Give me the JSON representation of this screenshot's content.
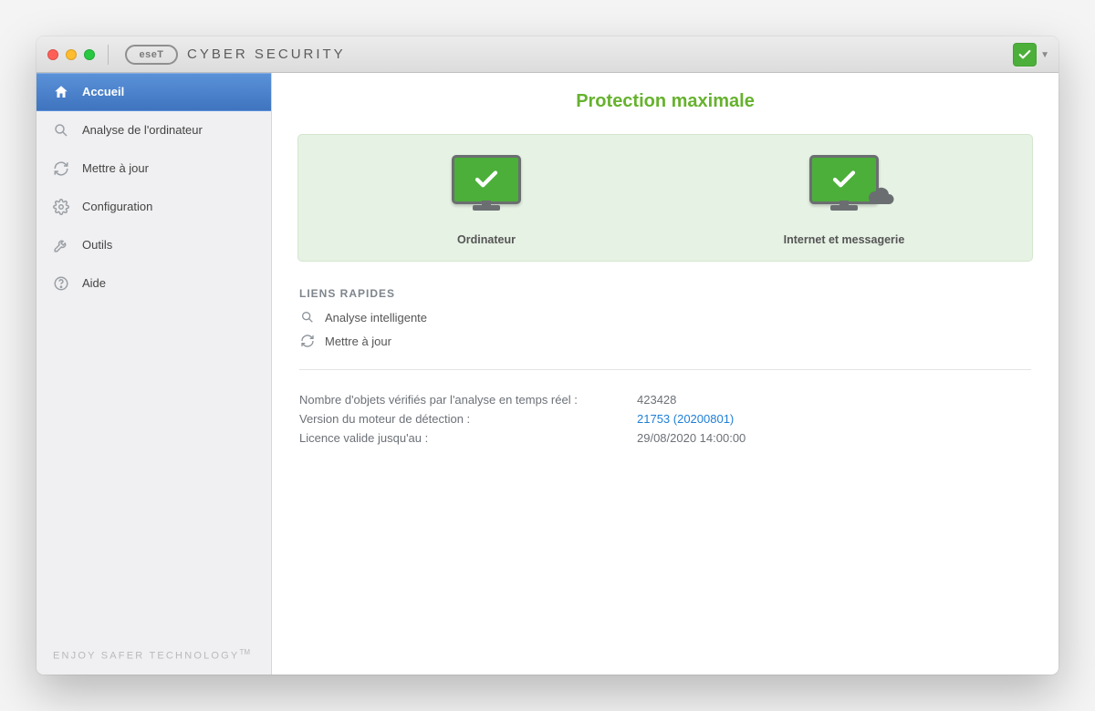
{
  "brand": {
    "logo_text": "eseT",
    "title": "CYBER SECURITY"
  },
  "sidebar": {
    "items": [
      {
        "label": "Accueil",
        "icon": "home-icon",
        "active": true
      },
      {
        "label": "Analyse de l'ordinateur",
        "icon": "search-icon"
      },
      {
        "label": "Mettre à jour",
        "icon": "refresh-icon"
      },
      {
        "label": "Configuration",
        "icon": "gear-icon"
      },
      {
        "label": "Outils",
        "icon": "tools-icon"
      },
      {
        "label": "Aide",
        "icon": "help-icon"
      }
    ],
    "footer": "ENJOY SAFER TECHNOLOGY",
    "footer_tm": "TM"
  },
  "main": {
    "headline": "Protection maximale",
    "cards": [
      {
        "label": "Ordinateur"
      },
      {
        "label": "Internet et messagerie"
      }
    ],
    "quicklinks_title": "LIENS RAPIDES",
    "quicklinks": [
      {
        "label": "Analyse intelligente",
        "icon": "search-icon"
      },
      {
        "label": "Mettre à jour",
        "icon": "refresh-icon"
      }
    ],
    "info": {
      "rows": [
        {
          "label": "Nombre d'objets vérifiés par l'analyse en temps réel :",
          "value": "423428",
          "link": false
        },
        {
          "label": "Version du moteur de détection :",
          "value": "21753 (20200801)",
          "link": true
        },
        {
          "label": "Licence valide jusqu'au :",
          "value": "29/08/2020 14:00:00",
          "link": false
        }
      ]
    }
  },
  "colors": {
    "accent_green": "#66b22e",
    "status_green": "#4caf3a",
    "link_blue": "#1f7fd6",
    "sidebar_active": "#3f74bf"
  }
}
